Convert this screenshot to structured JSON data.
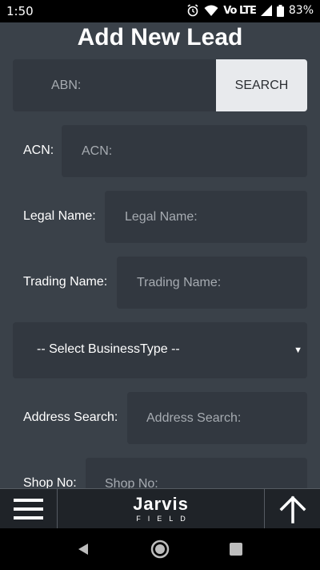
{
  "status_bar": {
    "time": "1:50",
    "network_label": "Vo LTE",
    "battery": "83%"
  },
  "page": {
    "title": "Add New Lead"
  },
  "form": {
    "abn": {
      "placeholder": "ABN:"
    },
    "search_button": "SEARCH",
    "acn": {
      "label": "ACN:",
      "placeholder": "ACN:"
    },
    "legal_name": {
      "label": "Legal Name:",
      "placeholder": "Legal Name:"
    },
    "trading_name": {
      "label": "Trading Name:",
      "placeholder": "Trading Name:"
    },
    "business_type": {
      "selected": "-- Select BusinessType --"
    },
    "address_search": {
      "label": "Address Search:",
      "placeholder": "Address Search:"
    },
    "shop_no": {
      "label": "Shop No:",
      "placeholder": "Shop No:"
    }
  },
  "app_bar": {
    "logo_main": "Jarvis",
    "logo_sub": "FIELD"
  },
  "icons": {
    "status": [
      "alarm-icon",
      "wifi-icon",
      "signal-icon",
      "battery-icon"
    ],
    "app_bar": [
      "hamburger-menu-icon",
      "arrow-up-icon"
    ],
    "nav": [
      "back-icon",
      "home-icon",
      "recents-icon"
    ]
  },
  "colors": {
    "background": "#3a4149",
    "field_background": "#323840",
    "search_button_background": "#e8eaed",
    "app_bar_background": "#1f2328"
  }
}
